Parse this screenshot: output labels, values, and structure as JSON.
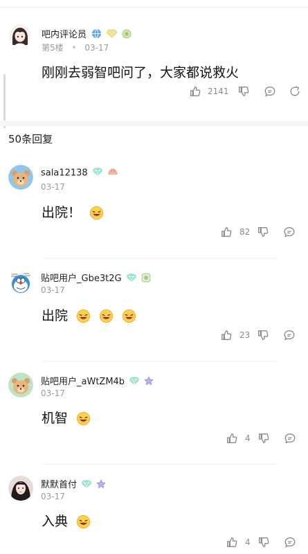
{
  "post": {
    "username": "吧内评论员",
    "floor": "第5楼",
    "date": "03-17",
    "content": "刚刚去弱智吧问了，大家都说救火",
    "likes": "2141"
  },
  "reply_count": "50条回复",
  "replies": [
    {
      "username": "sala12138",
      "date": "03-17",
      "content": "出院！",
      "likes": "82"
    },
    {
      "username": "贴吧用户_Gbe3t2G",
      "date": "03-17",
      "content": "出院",
      "likes": "23"
    },
    {
      "username": "贴吧用户_aWtZM4b",
      "date": "03-17",
      "content": "机智",
      "likes": "4"
    },
    {
      "username": "默默首付",
      "date": "03-17",
      "content": "入典",
      "likes": "4"
    }
  ],
  "icons": [
    "thumb-up-icon",
    "thumb-down-icon",
    "comment-icon",
    "share-icon",
    "diamond-badge-icon",
    "level-badge-icon",
    "laugh-emoji-icon"
  ],
  "colors": {
    "icon_gray": "#8a8a8a",
    "badge_teal": "#7fd6c8",
    "text": "#1f1f1f",
    "meta": "#9b9b9b"
  }
}
